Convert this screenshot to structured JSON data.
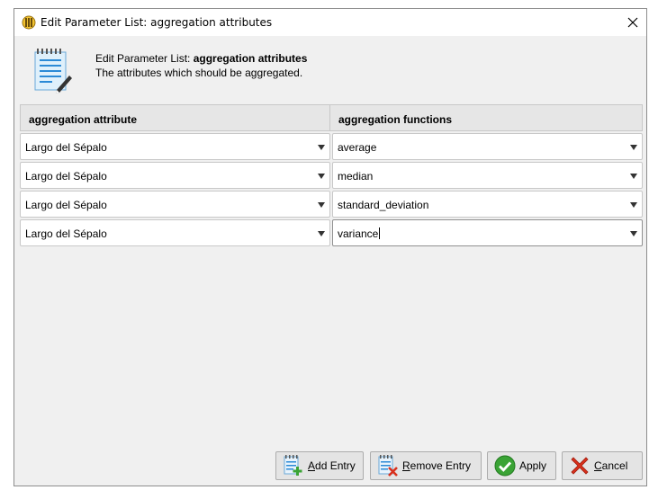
{
  "window": {
    "title": "Edit Parameter List: aggregation attributes"
  },
  "header": {
    "title_prefix": "Edit Parameter List: ",
    "title_bold": "aggregation attributes",
    "description": "The attributes which should be aggregated."
  },
  "table": {
    "columns": [
      "aggregation attribute",
      "aggregation functions"
    ],
    "rows": [
      {
        "attribute": "Largo del Sépalo",
        "function": "average"
      },
      {
        "attribute": "Largo del Sépalo",
        "function": "median"
      },
      {
        "attribute": "Largo del Sépalo",
        "function": "standard_deviation"
      },
      {
        "attribute": "Largo del Sépalo",
        "function": "variance"
      }
    ]
  },
  "buttons": {
    "add": {
      "mnemonic": "A",
      "rest": "dd Entry"
    },
    "remove": {
      "mnemonic": "R",
      "rest": "emove Entry"
    },
    "apply": {
      "label": "Apply"
    },
    "cancel": {
      "mnemonic": "C",
      "rest": "ancel"
    }
  },
  "icons": {
    "title": "app-logo-icon",
    "header": "notepad-edit-icon",
    "add": "list-add-icon",
    "remove": "list-remove-icon",
    "apply": "check-circle-icon",
    "cancel": "red-x-icon"
  },
  "colors": {
    "dialog_bg": "#f0f0f0",
    "header_bg": "#e6e6e6",
    "apply_green": "#3aa335",
    "cancel_red": "#d9301c"
  }
}
